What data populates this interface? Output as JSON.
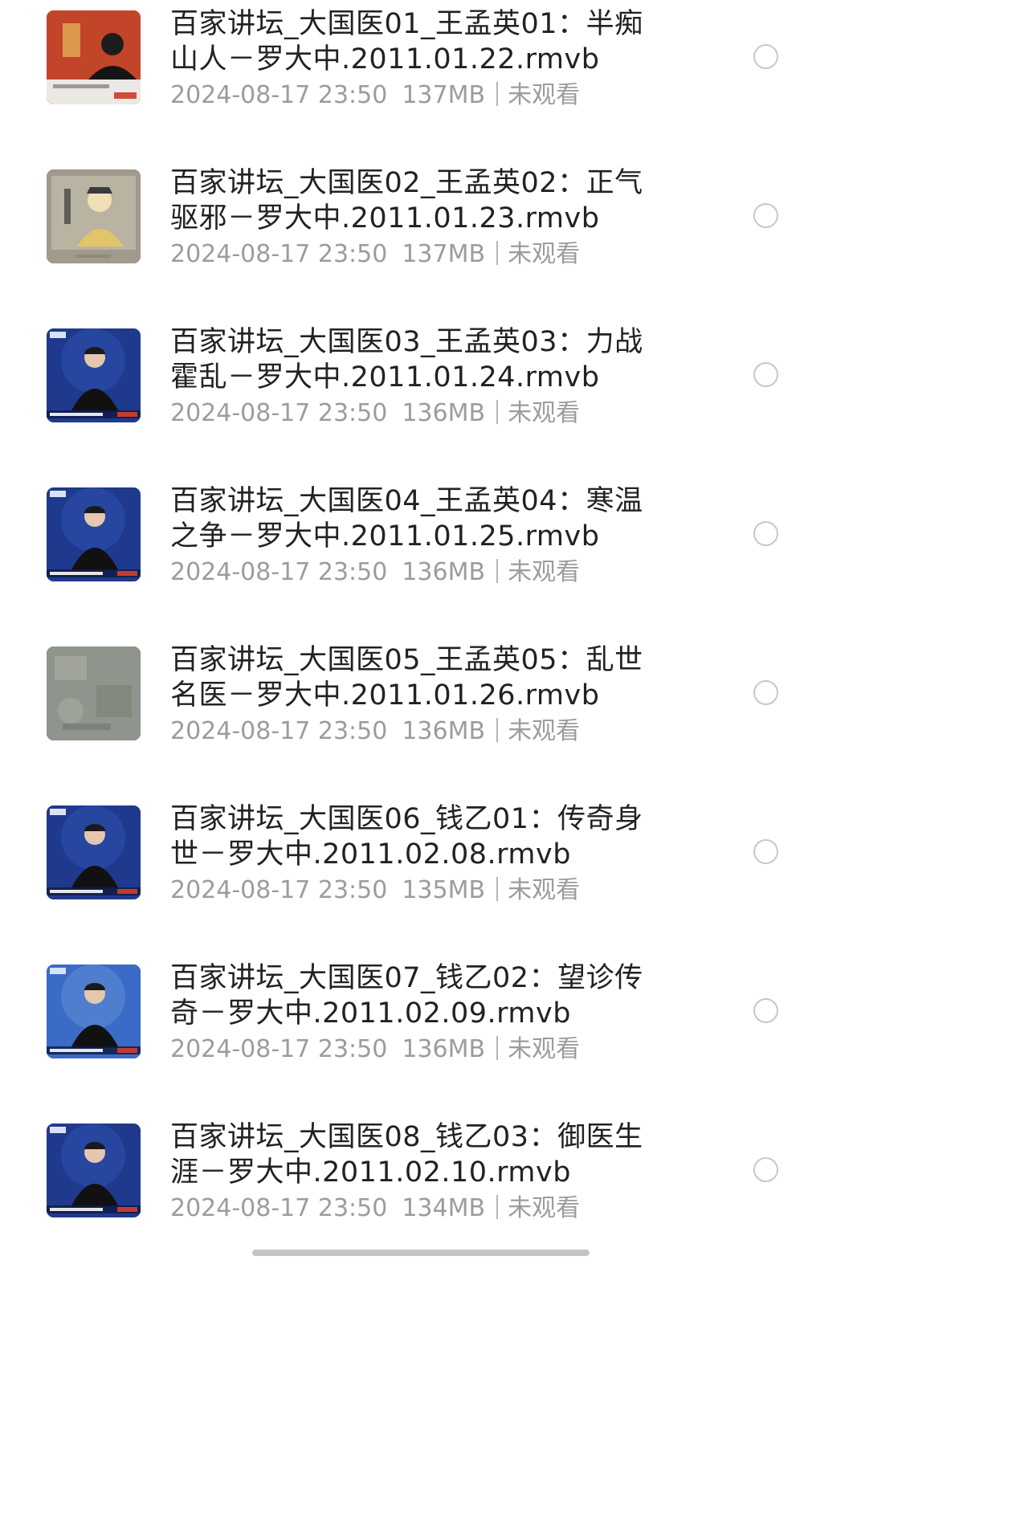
{
  "files": [
    {
      "title_line1": "百家讲坛_大国医01_王孟英01：半痴",
      "title_line2": "山人－罗大中.2011.01.22.rmvb",
      "date": "2024-08-17 23:50",
      "size": "137MB",
      "status": "未观看",
      "thumb_style": "red",
      "thumb_caption": "",
      "thumb_logo": ""
    },
    {
      "title_line1": "百家讲坛_大国医02_王孟英02：正气",
      "title_line2": "驱邪－罗大中.2011.01.23.rmvb",
      "date": "2024-08-17 23:50",
      "size": "137MB",
      "status": "未观看",
      "thumb_style": "portrait",
      "thumb_caption": "",
      "thumb_logo": ""
    },
    {
      "title_line1": "百家讲坛_大国医03_王孟英03：力战",
      "title_line2": "霍乱－罗大中.2011.01.24.rmvb",
      "date": "2024-08-17 23:50",
      "size": "136MB",
      "status": "未观看",
      "thumb_style": "stage",
      "thumb_caption": "",
      "thumb_logo": ""
    },
    {
      "title_line1": "百家讲坛_大国医04_王孟英04：寒温",
      "title_line2": "之争－罗大中.2011.01.25.rmvb",
      "date": "2024-08-17 23:50",
      "size": "136MB",
      "status": "未观看",
      "thumb_style": "stage",
      "thumb_caption": "",
      "thumb_logo": ""
    },
    {
      "title_line1": "百家讲坛_大国医05_王孟英05：乱世",
      "title_line2": "名医－罗大中.2011.01.26.rmvb",
      "date": "2024-08-17 23:50",
      "size": "136MB",
      "status": "未观看",
      "thumb_style": "gray",
      "thumb_caption": "",
      "thumb_logo": ""
    },
    {
      "title_line1": "百家讲坛_大国医06_钱乙01：传奇身",
      "title_line2": "世－罗大中.2011.02.08.rmvb",
      "date": "2024-08-17 23:50",
      "size": "135MB",
      "status": "未观看",
      "thumb_style": "stage",
      "thumb_caption": "",
      "thumb_logo": ""
    },
    {
      "title_line1": "百家讲坛_大国医07_钱乙02：望诊传",
      "title_line2": "奇－罗大中.2011.02.09.rmvb",
      "date": "2024-08-17 23:50",
      "size": "136MB",
      "status": "未观看",
      "thumb_style": "stage-light",
      "thumb_caption": "",
      "thumb_logo": ""
    },
    {
      "title_line1": "百家讲坛_大国医08_钱乙03：御医生",
      "title_line2": "涯－罗大中.2011.02.10.rmvb",
      "date": "2024-08-17 23:50",
      "size": "134MB",
      "status": "未观看",
      "thumb_style": "stage",
      "thumb_caption": "",
      "thumb_logo": ""
    }
  ],
  "icons": {
    "thumbnail": "video-thumbnail-icon",
    "select": "radio-circle-icon"
  },
  "colors": {
    "title": "#222222",
    "meta": "#9c9c9c",
    "radio_border": "#c8c8c8",
    "home_bar": "#c4c4c4"
  }
}
